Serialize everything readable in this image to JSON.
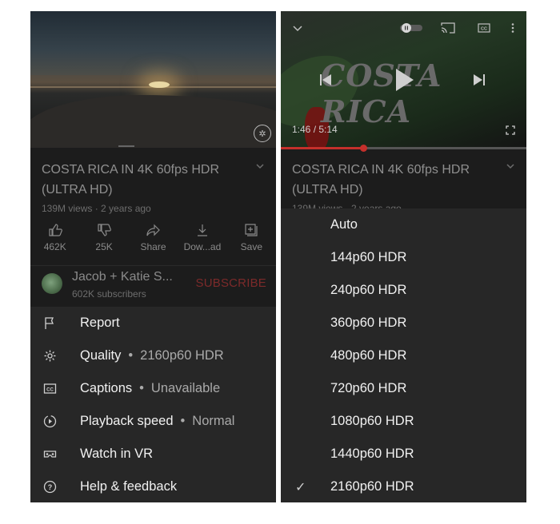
{
  "left": {
    "video": {
      "title": "COSTA RICA IN 4K 60fps HDR (ULTRA HD)",
      "meta": "139M views · 2 years ago"
    },
    "actions": [
      {
        "icon": "thumbs-up-icon",
        "label": "462K"
      },
      {
        "icon": "thumbs-down-icon",
        "label": "25K"
      },
      {
        "icon": "share-icon",
        "label": "Share"
      },
      {
        "icon": "download-icon",
        "label": "Dow...ad"
      },
      {
        "icon": "save-to-playlist-icon",
        "label": "Save"
      }
    ],
    "channel": {
      "name": "Jacob + Katie S...",
      "subscribers": "602K subscribers",
      "subscribe_label": "SUBSCRIBE"
    },
    "menu": [
      {
        "icon": "flag-icon",
        "label": "Report",
        "value": ""
      },
      {
        "icon": "gear-icon",
        "label": "Quality",
        "value": "2160p60 HDR"
      },
      {
        "icon": "cc-icon",
        "label": "Captions",
        "value": "Unavailable"
      },
      {
        "icon": "playback-speed-icon",
        "label": "Playback speed",
        "value": "Normal"
      },
      {
        "icon": "vr-headset-icon",
        "label": "Watch in VR",
        "value": ""
      },
      {
        "icon": "help-icon",
        "label": "Help & feedback",
        "value": ""
      }
    ]
  },
  "right": {
    "player": {
      "overlay_title": "COSTA RICA",
      "current_time": "1:46 / 5:14",
      "progress": 0.338
    },
    "video": {
      "title": "COSTA RICA IN 4K 60fps HDR (ULTRA HD)",
      "meta": "139M views · 2 years ago"
    },
    "quality_options": [
      {
        "label": "Auto",
        "selected": false
      },
      {
        "label": "144p60 HDR",
        "selected": false
      },
      {
        "label": "240p60 HDR",
        "selected": false
      },
      {
        "label": "360p60 HDR",
        "selected": false
      },
      {
        "label": "480p60 HDR",
        "selected": false
      },
      {
        "label": "720p60 HDR",
        "selected": false
      },
      {
        "label": "1080p60 HDR",
        "selected": false
      },
      {
        "label": "1440p60 HDR",
        "selected": false
      },
      {
        "label": "2160p60 HDR",
        "selected": true
      }
    ]
  },
  "colors": {
    "accent_red": "#c4302b",
    "subscribe_dim": "#7c2a2a",
    "sheet_bg": "#272727"
  }
}
